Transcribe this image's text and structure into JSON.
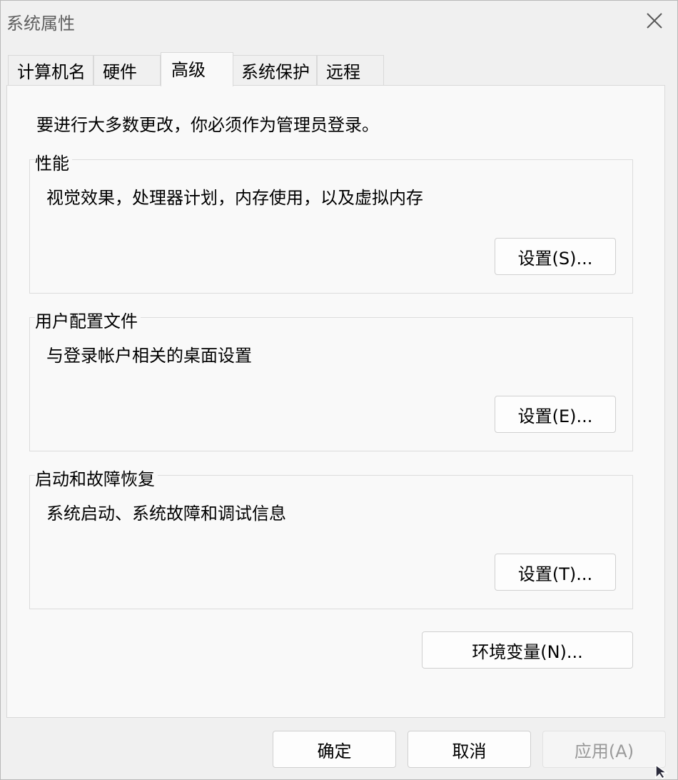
{
  "window": {
    "title": "系统属性"
  },
  "tabs": [
    {
      "label": "计算机名"
    },
    {
      "label": "硬件"
    },
    {
      "label": "高级"
    },
    {
      "label": "系统保护"
    },
    {
      "label": "远程"
    }
  ],
  "active_tab": "高级",
  "admin_note": "要进行大多数更改，你必须作为管理员登录。",
  "groups": {
    "performance": {
      "legend": "性能",
      "description": "视觉效果，处理器计划，内存使用，以及虚拟内存",
      "button": "设置(S)..."
    },
    "user_profiles": {
      "legend": "用户配置文件",
      "description": "与登录帐户相关的桌面设置",
      "button": "设置(E)..."
    },
    "startup_recovery": {
      "legend": "启动和故障恢复",
      "description": "系统启动、系统故障和调试信息",
      "button": "设置(T)..."
    }
  },
  "env_button": "环境变量(N)...",
  "footer": {
    "ok": "确定",
    "cancel": "取消",
    "apply": "应用(A)"
  },
  "icons": {
    "close": "close-icon",
    "cursor": "mouse-pointer-icon"
  }
}
